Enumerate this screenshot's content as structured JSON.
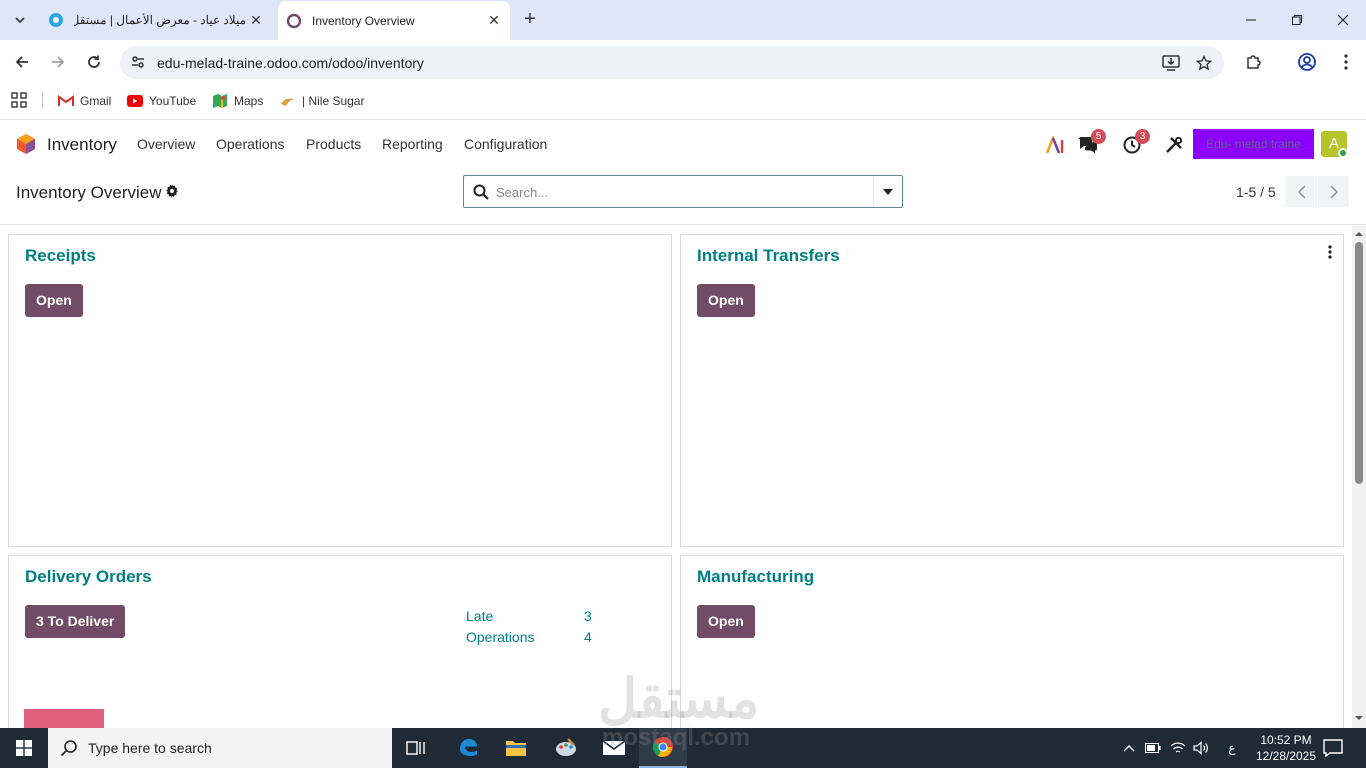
{
  "browser": {
    "tabs": [
      {
        "title": "ميلاد عياد - معرض الأعمال | مستقل",
        "active": false
      },
      {
        "title": "Inventory Overview",
        "active": true
      }
    ],
    "url": "edu-melad-traine.odoo.com/odoo/inventory",
    "bookmarks": [
      "Gmail",
      "YouTube",
      "Maps",
      "| Nile Sugar"
    ]
  },
  "odoo": {
    "app_name": "Inventory",
    "menu": [
      "Overview",
      "Operations",
      "Products",
      "Reporting",
      "Configuration"
    ],
    "messages_badge": "5",
    "activities_badge": "3",
    "company": "Edu- melad traine",
    "avatar_letter": "A"
  },
  "control": {
    "breadcrumb": "Inventory Overview",
    "search_placeholder": "Search...",
    "pager": "1-5 / 5"
  },
  "cards": [
    {
      "title": "Receipts",
      "button": "Open"
    },
    {
      "title": "Internal Transfers",
      "button": "Open"
    },
    {
      "title": "Delivery Orders",
      "button": "3 To Deliver",
      "stats": [
        {
          "label": "Late",
          "value": "3"
        },
        {
          "label": "Operations",
          "value": "4"
        }
      ]
    },
    {
      "title": "Manufacturing",
      "button": "Open"
    }
  ],
  "watermark": {
    "text": "مستقل",
    "sub": "mostaql.com"
  },
  "taskbar": {
    "search_text": "Type here to search",
    "time": "10:52 PM",
    "date": "12/28/2025",
    "lang": "ع"
  },
  "colors": {
    "odoo_primary": "#714b67",
    "odoo_teal": "#017e84",
    "chrome_tabbar": "#dfe6f7",
    "taskbar": "#1e2a36"
  }
}
